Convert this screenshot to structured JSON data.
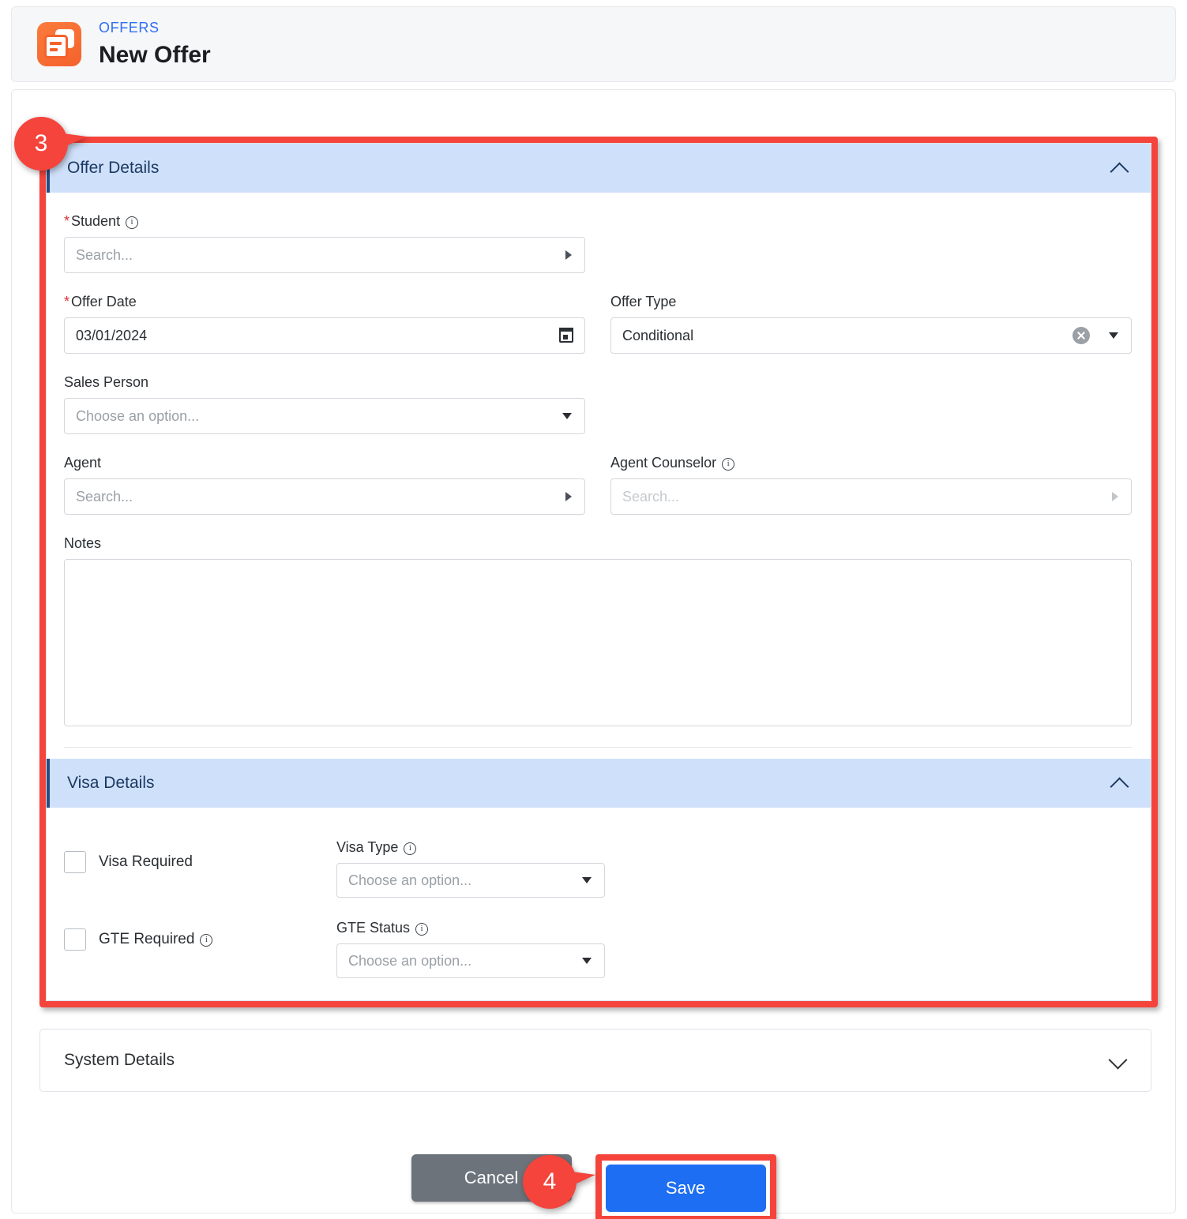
{
  "header": {
    "breadcrumb": "OFFERS",
    "title": "New Offer",
    "icon": "offers-app-icon"
  },
  "steps": [
    {
      "number": "3",
      "points_to": "offer-details-and-visa-details-panels"
    },
    {
      "number": "4",
      "points_to": "save-button"
    }
  ],
  "sections": {
    "offer_details": {
      "title": "Offer Details",
      "expanded": true,
      "collapse_icon": "chevron-up-icon",
      "fields": {
        "student": {
          "label": "Student",
          "required": true,
          "required_marker": "*",
          "has_info": true,
          "placeholder": "Search...",
          "value": "",
          "control": "lookup-search",
          "trigger_icon": "caret-right-icon"
        },
        "offer_date": {
          "label": "Offer Date",
          "required": true,
          "required_marker": "*",
          "has_info": false,
          "value": "03/01/2024",
          "control": "date",
          "trigger_icon": "calendar-icon"
        },
        "offer_type": {
          "label": "Offer Type",
          "required": false,
          "has_info": false,
          "value": "Conditional",
          "control": "select",
          "clear_icon": "clear-circle-x-icon",
          "trigger_icon": "caret-down-icon"
        },
        "sales_person": {
          "label": "Sales Person",
          "required": false,
          "has_info": false,
          "placeholder": "Choose an option...",
          "value": "",
          "control": "select",
          "trigger_icon": "caret-down-icon"
        },
        "agent": {
          "label": "Agent",
          "required": false,
          "has_info": false,
          "placeholder": "Search...",
          "value": "",
          "control": "lookup-search",
          "trigger_icon": "caret-right-icon"
        },
        "agent_counselor": {
          "label": "Agent Counselor",
          "required": false,
          "has_info": true,
          "placeholder": "Search...",
          "value": "",
          "disabled": true,
          "control": "lookup-search",
          "trigger_icon": "caret-right-icon"
        },
        "notes": {
          "label": "Notes",
          "required": false,
          "has_info": false,
          "value": "",
          "control": "textarea"
        }
      }
    },
    "visa_details": {
      "title": "Visa Details",
      "expanded": true,
      "collapse_icon": "chevron-up-icon",
      "fields": {
        "visa_required": {
          "label": "Visa Required",
          "checked": false,
          "has_info": false,
          "control": "checkbox"
        },
        "gte_required": {
          "label": "GTE Required",
          "checked": false,
          "has_info": true,
          "control": "checkbox"
        },
        "visa_type": {
          "label": "Visa Type",
          "has_info": true,
          "placeholder": "Choose an option...",
          "value": "",
          "control": "select",
          "trigger_icon": "caret-down-icon"
        },
        "gte_status": {
          "label": "GTE Status",
          "has_info": true,
          "placeholder": "Choose an option...",
          "value": "",
          "control": "select",
          "trigger_icon": "caret-down-icon"
        }
      }
    },
    "system_details": {
      "title": "System Details",
      "expanded": false,
      "collapse_icon": "chevron-down-icon"
    }
  },
  "footer": {
    "cancel_label": "Cancel",
    "save_label": "Save"
  },
  "colors": {
    "brand_orange": "#f4622c",
    "breadcrumb_blue": "#2f6ff3",
    "section_header_bg": "#cfe0fa",
    "section_header_text": "#1b3a63",
    "highlight_red": "#f4443c",
    "save_blue": "#1d6ef2",
    "cancel_gray": "#6c737b",
    "required_red": "#e03131"
  }
}
